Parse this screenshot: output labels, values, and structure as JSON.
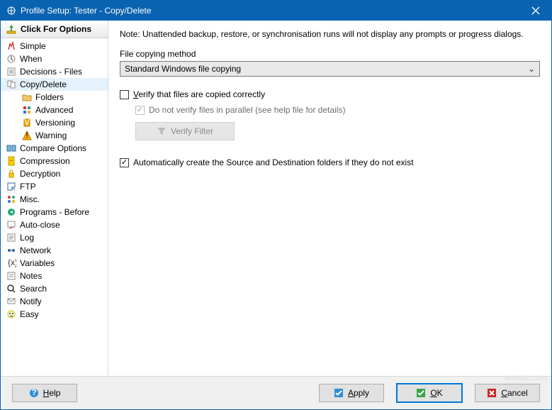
{
  "title": "Profile Setup: Tester - Copy/Delete",
  "optionsHeader": "Click For Options",
  "sidebar": [
    {
      "label": "Simple",
      "sub": false
    },
    {
      "label": "When",
      "sub": false
    },
    {
      "label": "Decisions - Files",
      "sub": false
    },
    {
      "label": "Copy/Delete",
      "sub": false,
      "selected": true
    },
    {
      "label": "Folders",
      "sub": true
    },
    {
      "label": "Advanced",
      "sub": true
    },
    {
      "label": "Versioning",
      "sub": true
    },
    {
      "label": "Warning",
      "sub": true
    },
    {
      "label": "Compare Options",
      "sub": false
    },
    {
      "label": "Compression",
      "sub": false
    },
    {
      "label": "Decryption",
      "sub": false
    },
    {
      "label": "FTP",
      "sub": false
    },
    {
      "label": "Misc.",
      "sub": false
    },
    {
      "label": "Programs - Before",
      "sub": false
    },
    {
      "label": "Auto-close",
      "sub": false
    },
    {
      "label": "Log",
      "sub": false
    },
    {
      "label": "Network",
      "sub": false
    },
    {
      "label": "Variables",
      "sub": false
    },
    {
      "label": "Notes",
      "sub": false
    },
    {
      "label": "Search",
      "sub": false
    },
    {
      "label": "Notify",
      "sub": false
    },
    {
      "label": "Easy",
      "sub": false
    }
  ],
  "main": {
    "note": "Note: Unattended backup, restore, or synchronisation runs will not display any prompts or progress dialogs.",
    "copyMethodLabel": "File copying method",
    "copyMethodValue": "Standard Windows file copying",
    "verifyLabel": "Verify that files are copied correctly",
    "verifyChecked": false,
    "noParallelLabel": "Do not verify files in parallel (see help file for details)",
    "noParallelChecked": true,
    "verifyFilterBtn": "Verify Filter",
    "autoCreateLabel": "Automatically create the Source and Destination folders if they do not exist",
    "autoCreateChecked": true
  },
  "footer": {
    "help": "Help",
    "apply": "Apply",
    "ok": "OK",
    "cancel": "Cancel"
  },
  "watermark": "wsxdn.com"
}
